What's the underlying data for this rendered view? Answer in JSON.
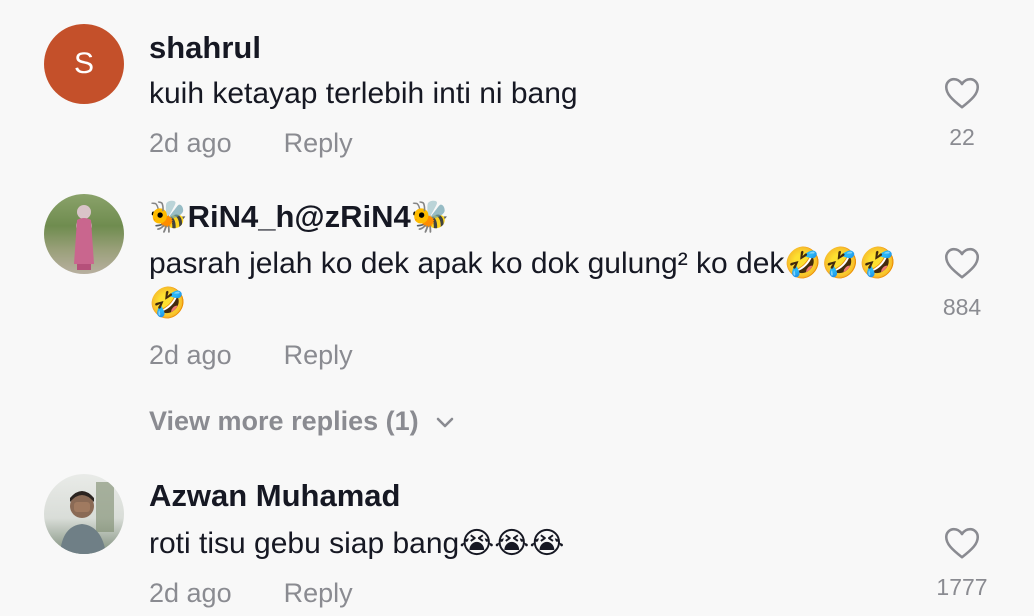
{
  "comments": [
    {
      "username": "shahrul",
      "avatar_letter": "S",
      "text": "kuih ketayap terlebih inti ni bang",
      "time": "2d ago",
      "reply": "Reply",
      "likes": "22",
      "icon": "heart-outline-icon"
    },
    {
      "username": "🐝RiN4_h@zRiN4🐝",
      "text": "pasrah jelah ko dek apak ko dok gulung² ko dek🤣🤣🤣🤣",
      "time": "2d ago",
      "reply": "Reply",
      "likes": "884",
      "icon": "heart-outline-icon"
    },
    {
      "username": "Azwan Muhamad",
      "text": "roti tisu gebu siap bang😭😭😭",
      "time": "2d ago",
      "reply": "Reply",
      "likes": "1777",
      "icon": "heart-outline-icon"
    }
  ],
  "view_more": {
    "label": "View more replies (1)",
    "icon": "chevron-down-icon"
  },
  "colors": {
    "background": "#f8f8f8",
    "text": "#161823",
    "muted": "#8a8b91",
    "avatar_s": "#c4502a"
  }
}
